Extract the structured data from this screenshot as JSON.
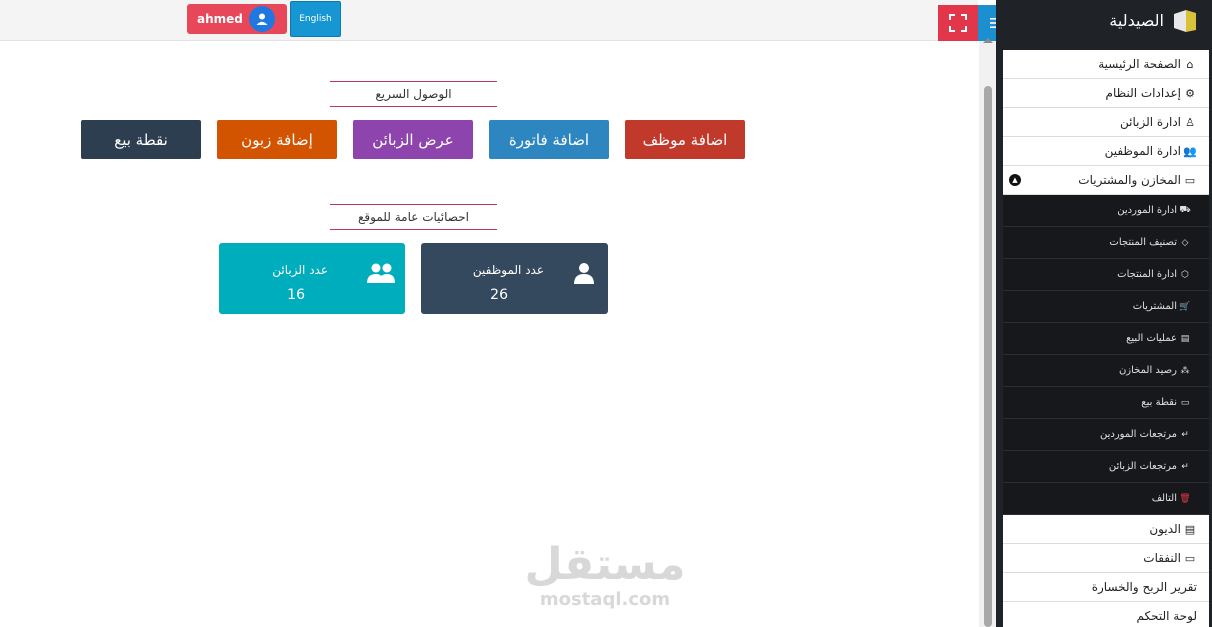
{
  "header": {
    "user_name": "ahmed",
    "language_label": "English"
  },
  "brand": {
    "title": "الصيدلية"
  },
  "sidebar": {
    "items": [
      {
        "label": "الصفحة الرئيسية",
        "icon": "⌂"
      },
      {
        "label": "إعدادات النظام",
        "icon": "⚙"
      },
      {
        "label": "ادارة الزبائن",
        "icon": "♙"
      },
      {
        "label": "ادارة الموظفين",
        "icon": "👥"
      },
      {
        "label": "المخازن والمشتريات",
        "icon": "▭"
      }
    ],
    "subitems": [
      {
        "label": "ادارة الموردين",
        "icon": "⛟"
      },
      {
        "label": "تصنيف المنتجات",
        "icon": "◇"
      },
      {
        "label": "ادارة المنتجات",
        "icon": "⬡"
      },
      {
        "label": "المشتريات",
        "icon": "🛒"
      },
      {
        "label": "عمليات البيع",
        "icon": "▤"
      },
      {
        "label": "رصيد المخازن",
        "icon": "⁂"
      },
      {
        "label": "نقطة بيع",
        "icon": "▭"
      },
      {
        "label": "مرتجعات الموردين",
        "icon": "↵"
      },
      {
        "label": "مرتجعات الزبائن",
        "icon": "↵"
      },
      {
        "label": "التالف",
        "icon": "🗑"
      }
    ],
    "bottom_items": [
      {
        "label": "الديون",
        "icon": "▤"
      },
      {
        "label": "النفقات",
        "icon": "▭"
      },
      {
        "label": "تقرير الربح والخسارة",
        "icon": ""
      },
      {
        "label": "لوحة التحكم",
        "icon": ""
      }
    ]
  },
  "quick_access": {
    "title": "الوصول السريع",
    "buttons": [
      {
        "label": "اضافة موظف",
        "color": "#c0392b"
      },
      {
        "label": "اضافة فاتورة",
        "color": "#2e86c1"
      },
      {
        "label": "عرض الزبائن",
        "color": "#8e44ad"
      },
      {
        "label": "إضافة زبون",
        "color": "#d35400"
      },
      {
        "label": "نقطة بيع",
        "color": "#2c3e50"
      }
    ]
  },
  "stats": {
    "title": "احصائيات عامة للموقع",
    "cards": [
      {
        "label": "عدد الموظفين",
        "value": "26",
        "color": "#34495e"
      },
      {
        "label": "عدد الزبائن",
        "value": "16",
        "color": "#00adbd"
      }
    ]
  },
  "watermark": {
    "arabic": "مستقل",
    "english": "mostaql.com"
  }
}
